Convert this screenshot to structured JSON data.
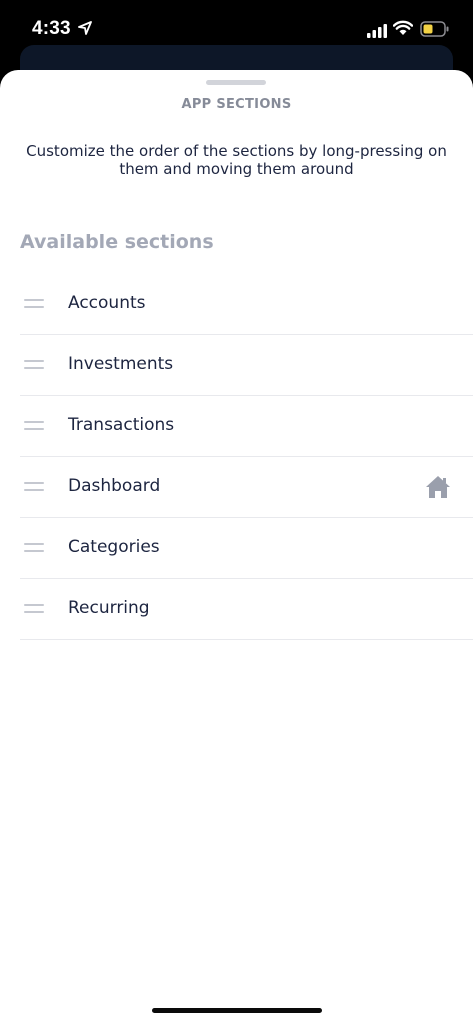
{
  "status_bar": {
    "time": "4:33"
  },
  "sheet": {
    "title": "APP SECTIONS",
    "description": "Customize the order of the sections by long-pressing on them and moving them around",
    "heading": "Available sections",
    "sections": [
      {
        "label": "Accounts",
        "home": false
      },
      {
        "label": "Investments",
        "home": false
      },
      {
        "label": "Transactions",
        "home": false
      },
      {
        "label": "Dashboard",
        "home": true
      },
      {
        "label": "Categories",
        "home": false
      },
      {
        "label": "Recurring",
        "home": false
      }
    ]
  },
  "colors": {
    "text_primary": "#1d2540",
    "text_muted": "#a3a8b6",
    "divider": "#e8e9ed",
    "battery_low": "#f2d245"
  },
  "icons": [
    "location-arrow-icon",
    "signal-icon",
    "wifi-icon",
    "battery-icon",
    "drag-handle-icon",
    "home-icon"
  ]
}
